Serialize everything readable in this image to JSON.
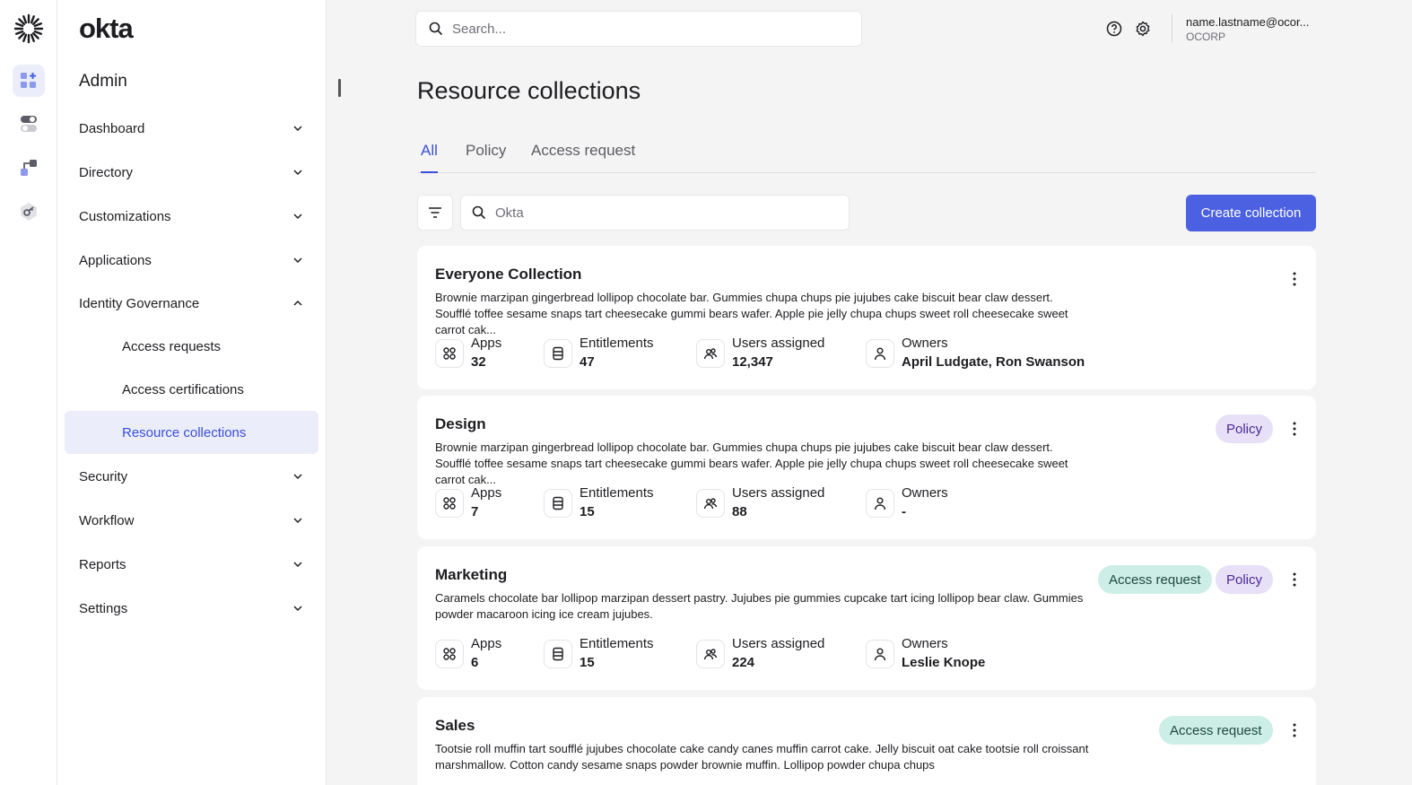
{
  "rail": {
    "items": [
      "admin-dashboard-icon",
      "toggle-icon",
      "workflow-icon",
      "key-icon"
    ]
  },
  "brand": {
    "name": "okta"
  },
  "sidebar": {
    "title": "Admin",
    "items": [
      {
        "label": "Dashboard"
      },
      {
        "label": "Directory"
      },
      {
        "label": "Customizations"
      },
      {
        "label": "Applications"
      },
      {
        "label": "Identity Governance"
      },
      {
        "label": "Security"
      },
      {
        "label": "Workflow"
      },
      {
        "label": "Reports"
      },
      {
        "label": "Settings"
      }
    ],
    "sub_items": [
      {
        "label": "Access requests"
      },
      {
        "label": "Access certifications"
      },
      {
        "label": "Resource collections"
      }
    ]
  },
  "topbar": {
    "search_placeholder": "Search...",
    "user_email": "name.lastname@ocor...",
    "user_org": "OCORP"
  },
  "main": {
    "title": "Resource collections",
    "tabs": [
      {
        "label": "All"
      },
      {
        "label": "Policy"
      },
      {
        "label": "Access request"
      }
    ],
    "search_placeholder": "Okta",
    "create_label": "Create collection",
    "metric_labels": {
      "apps": "Apps",
      "entitlements": "Entitlements",
      "users": "Users assigned",
      "owners": "Owners"
    },
    "cards": [
      {
        "title": "Everyone Collection",
        "desc": "Brownie marzipan gingerbread lollipop chocolate bar. Gummies chupa chups pie jujubes cake biscuit bear claw dessert. Soufflé toffee sesame snaps tart cheesecake gummi bears wafer. Apple pie jelly chupa chups sweet roll cheesecake sweet carrot cak...",
        "apps": "32",
        "entitlements": "47",
        "users": "12,347",
        "owners": "April Ludgate, Ron Swanson"
      },
      {
        "title": "Design",
        "desc": "Brownie marzipan gingerbread lollipop chocolate bar. Gummies chupa chups pie jujubes cake biscuit bear claw dessert. Soufflé toffee sesame snaps tart cheesecake gummi bears wafer. Apple pie jelly chupa chups sweet roll cheesecake sweet carrot cak...",
        "tags": [
          "Policy"
        ],
        "apps": "7",
        "entitlements": "15",
        "users": "88",
        "owners": "-"
      },
      {
        "title": "Marketing",
        "desc": "Caramels chocolate bar lollipop marzipan dessert pastry. Jujubes pie gummies cupcake tart icing lollipop bear claw. Gummies powder macaroon icing ice cream jujubes.",
        "tags": [
          "Access request",
          "Policy"
        ],
        "apps": "6",
        "entitlements": "15",
        "users": "224",
        "owners": "Leslie Knope"
      },
      {
        "title": "Sales",
        "desc": "Tootsie roll muffin tart soufflé jujubes chocolate cake candy canes muffin carrot cake. Jelly biscuit oat cake tootsie roll croissant marshmallow. Cotton candy sesame snaps powder brownie muffin. Lollipop powder chupa chups",
        "tags": [
          "Access request"
        ]
      }
    ]
  },
  "colors": {
    "accent": "#4c61e2",
    "active_bg": "#ebedfb",
    "policy_tag": "#e8e0f7",
    "access_tag": "#cdeee6"
  }
}
